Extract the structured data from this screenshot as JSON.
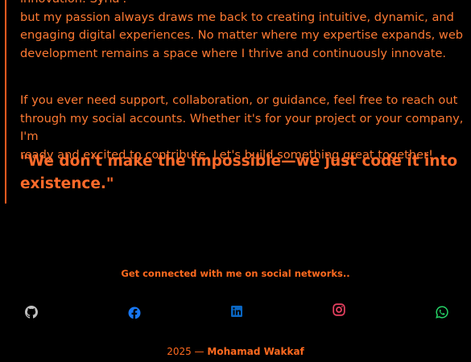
{
  "about": {
    "paragraph1_lines": [
      "innovation: Syria'.",
      "but my passion always draws me back to creating intuitive, dynamic, and",
      "engaging digital experiences. No matter where my expertise expands, web",
      "development remains a space where I thrive and continuously innovate."
    ],
    "paragraph2_lines": [
      "If you ever need support, collaboration, or guidance, feel free to reach out",
      "through my social accounts. Whether it's for your project or your company, I'm",
      "ready and excited to contribute. Let's build something great together!"
    ],
    "quote_lines": [
      "\"We don't make the impossible—we just code it into",
      "existence.\""
    ]
  },
  "social": {
    "heading": "Get connected with me on social networks..",
    "icons": [
      {
        "name": "github-icon",
        "color": "#c0c0c0"
      },
      {
        "name": "facebook-icon",
        "color": "#1877f2"
      },
      {
        "name": "linkedin-icon",
        "color": "#0a66c2"
      },
      {
        "name": "instagram-icon",
        "color": "#e4405f"
      },
      {
        "name": "whatsapp-icon",
        "color": "#25d366"
      }
    ]
  },
  "footer": {
    "year_text": "2025 —",
    "author": "Mohamad Wakkaf"
  },
  "colors": {
    "accent": "#ff6a1f",
    "background": "#000000"
  }
}
